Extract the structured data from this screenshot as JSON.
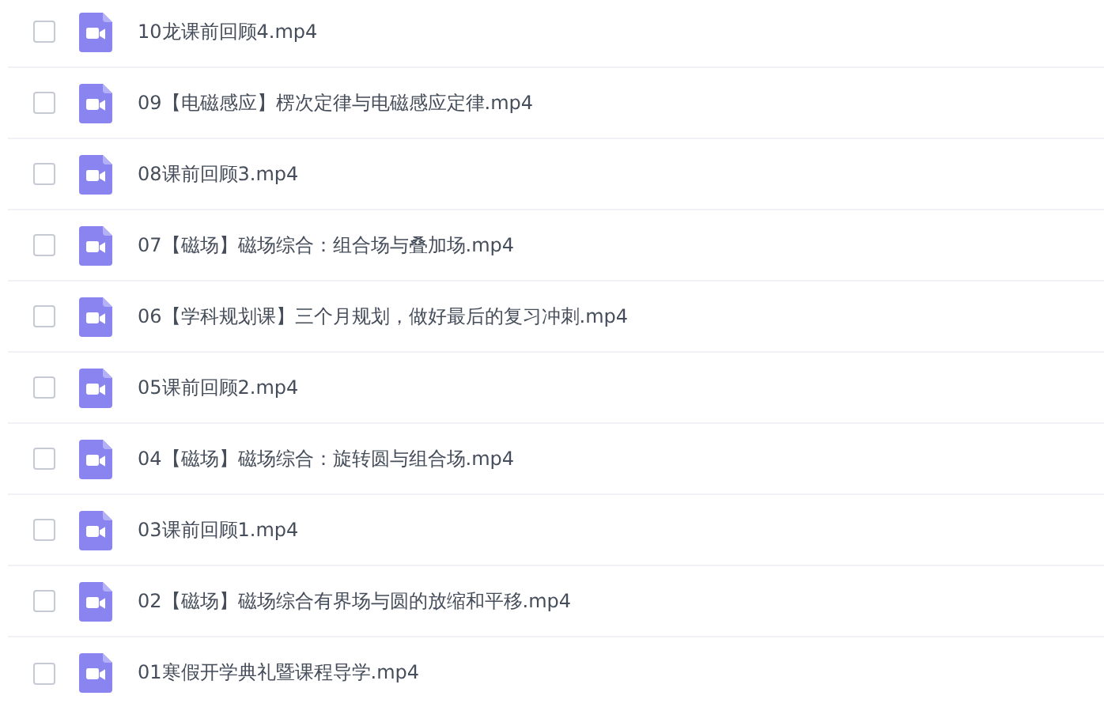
{
  "files": [
    {
      "name": "10龙课前回顾4.mp4",
      "checked": false
    },
    {
      "name": "09【电磁感应】楞次定律与电磁感应定律.mp4",
      "checked": false
    },
    {
      "name": "08课前回顾3.mp4",
      "checked": false
    },
    {
      "name": "07【磁场】磁场综合：组合场与叠加场.mp4",
      "checked": false
    },
    {
      "name": "06【学科规划课】三个月规划，做好最后的复习冲刺.mp4",
      "checked": false
    },
    {
      "name": "05课前回顾2.mp4",
      "checked": false
    },
    {
      "name": "04【磁场】磁场综合：旋转圆与组合场.mp4",
      "checked": false
    },
    {
      "name": "03课前回顾1.mp4",
      "checked": false
    },
    {
      "name": "02【磁场】磁场综合有界场与圆的放缩和平移.mp4",
      "checked": false
    },
    {
      "name": "01寒假开学典礼暨课程导学.mp4",
      "checked": false
    }
  ]
}
